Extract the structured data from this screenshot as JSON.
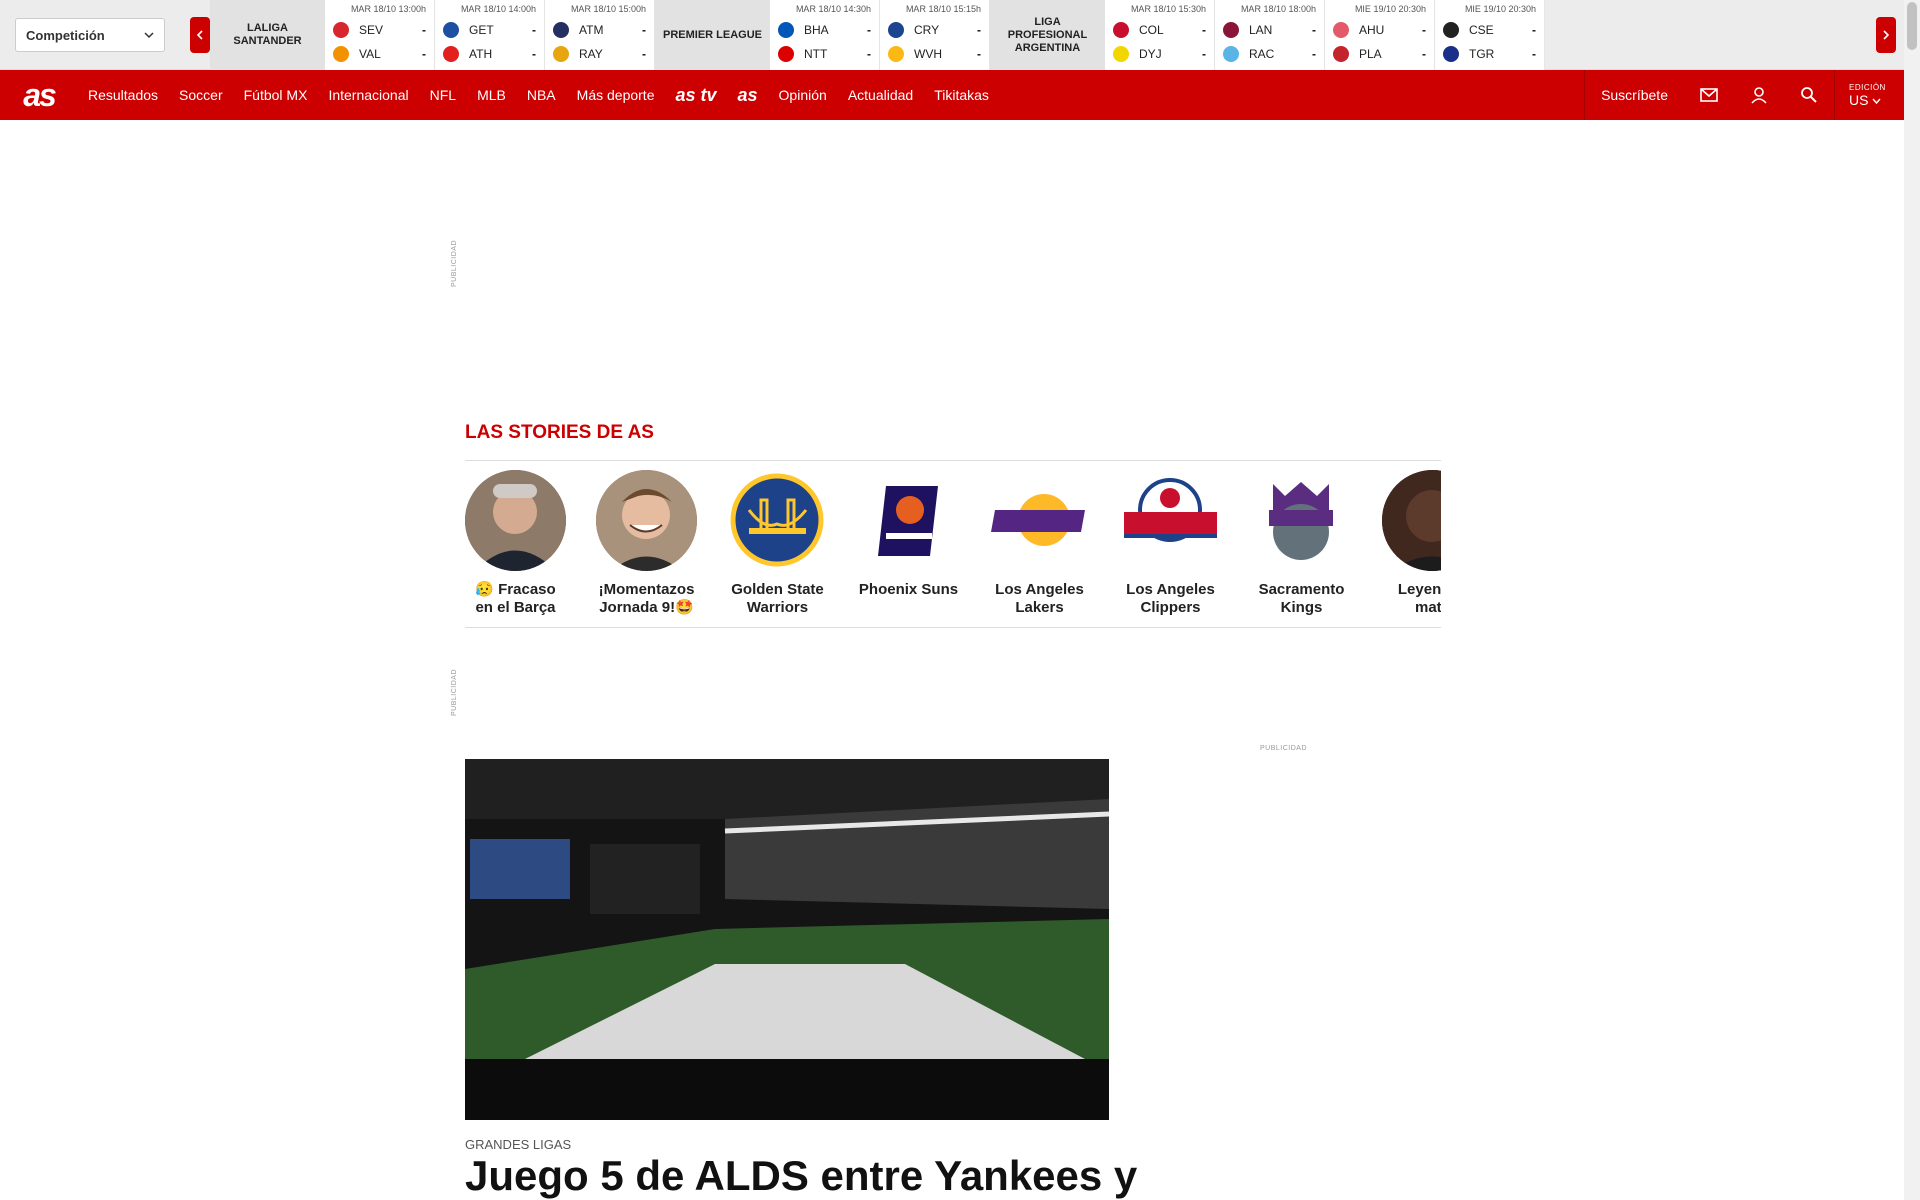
{
  "scores": {
    "competition_select": "Competición",
    "leagues": [
      {
        "name": "LALIGA SANTANDER",
        "matches": [
          {
            "date": "MAR 18/10 13:00h",
            "home": "SEV",
            "away": "VAL",
            "home_score": "-",
            "away_score": "-"
          },
          {
            "date": "MAR 18/10 14:00h",
            "home": "GET",
            "away": "ATH",
            "home_score": "-",
            "away_score": "-"
          },
          {
            "date": "MAR 18/10 15:00h",
            "home": "ATM",
            "away": "RAY",
            "home_score": "-",
            "away_score": "-"
          }
        ]
      },
      {
        "name": "PREMIER LEAGUE",
        "matches": [
          {
            "date": "MAR 18/10 14:30h",
            "home": "BHA",
            "away": "NTT",
            "home_score": "-",
            "away_score": "-"
          },
          {
            "date": "MAR 18/10 15:15h",
            "home": "CRY",
            "away": "WVH",
            "home_score": "-",
            "away_score": "-"
          }
        ]
      },
      {
        "name": "LIGA PROFESIONAL ARGENTINA",
        "matches": [
          {
            "date": "MAR 18/10 15:30h",
            "home": "COL",
            "away": "DYJ",
            "home_score": "-",
            "away_score": "-"
          },
          {
            "date": "MAR 18/10 18:00h",
            "home": "LAN",
            "away": "RAC",
            "home_score": "-",
            "away_score": "-"
          },
          {
            "date": "MIE 19/10 20:30h",
            "home": "AHU",
            "away": "PLA",
            "home_score": "-",
            "away_score": "-"
          },
          {
            "date": "MIE 19/10 20:30h",
            "home": "CSE",
            "away": "TGR",
            "home_score": "-",
            "away_score": "-"
          }
        ]
      }
    ]
  },
  "nav": {
    "logo": "as",
    "items": [
      "Resultados",
      "Soccer",
      "Fútbol MX",
      "Internacional",
      "NFL",
      "MLB",
      "NBA",
      "Más deporte",
      "as tv",
      "as ",
      "Opinión",
      "Actualidad",
      "Tikitakas"
    ],
    "subscribe": "Suscríbete",
    "edition_label": "EDICIÓN",
    "edition_value": "US"
  },
  "ads": {
    "label": "PUBLICIDAD"
  },
  "stories": {
    "title": "LAS STORIES DE AS",
    "items": [
      {
        "label": "😥 Fracaso en el Barça",
        "icon": "person-photo-icon"
      },
      {
        "label": "¡Momentazos Jornada 9!🤩",
        "icon": "person-photo-icon"
      },
      {
        "label": "Golden State Warriors",
        "icon": "warriors-logo-icon"
      },
      {
        "label": "Phoenix Suns",
        "icon": "suns-logo-icon"
      },
      {
        "label": "Los Angeles Lakers",
        "icon": "lakers-logo-icon"
      },
      {
        "label": "Los Angeles Clippers",
        "icon": "clippers-logo-icon"
      },
      {
        "label": "Sacramento Kings",
        "icon": "kings-logo-icon"
      },
      {
        "label": "Leyendas mate",
        "icon": "person-photo-icon"
      }
    ]
  },
  "article": {
    "kicker": "GRANDES LIGAS",
    "headline": "Juego 5 de ALDS entre Yankees y"
  },
  "colors": {
    "brand_red": "#cc0000"
  }
}
